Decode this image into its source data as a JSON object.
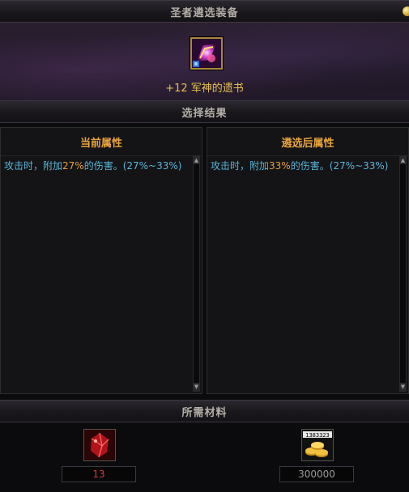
{
  "header": {
    "title": "圣者遴选装备"
  },
  "item": {
    "level": "+12",
    "name": "军神的遗书",
    "icon": "scroll-icon"
  },
  "results": {
    "title": "选择结果"
  },
  "left_panel": {
    "title": "当前属性",
    "text_before": "攻击时，附加",
    "value": "27%",
    "text_after": "的伤害。(27%~33%)"
  },
  "right_panel": {
    "title": "遴选后属性",
    "text_before": "攻击时，附加",
    "value": "33%",
    "text_after": "的伤害。(27%~33%)"
  },
  "materials": {
    "title": "所需材料",
    "items": [
      {
        "icon": "red-crystal-icon",
        "qty": "13",
        "qty_color": "#d83a3a"
      },
      {
        "icon": "gold-coins-icon",
        "counter": "1383323",
        "qty": "300000",
        "qty_color": "#9a9a9a"
      }
    ]
  },
  "colors": {
    "attr_text": "#5ab4d8",
    "highlight": "#e3a039",
    "panel_title": "#e8a43c",
    "item_name": "#e6c050"
  }
}
